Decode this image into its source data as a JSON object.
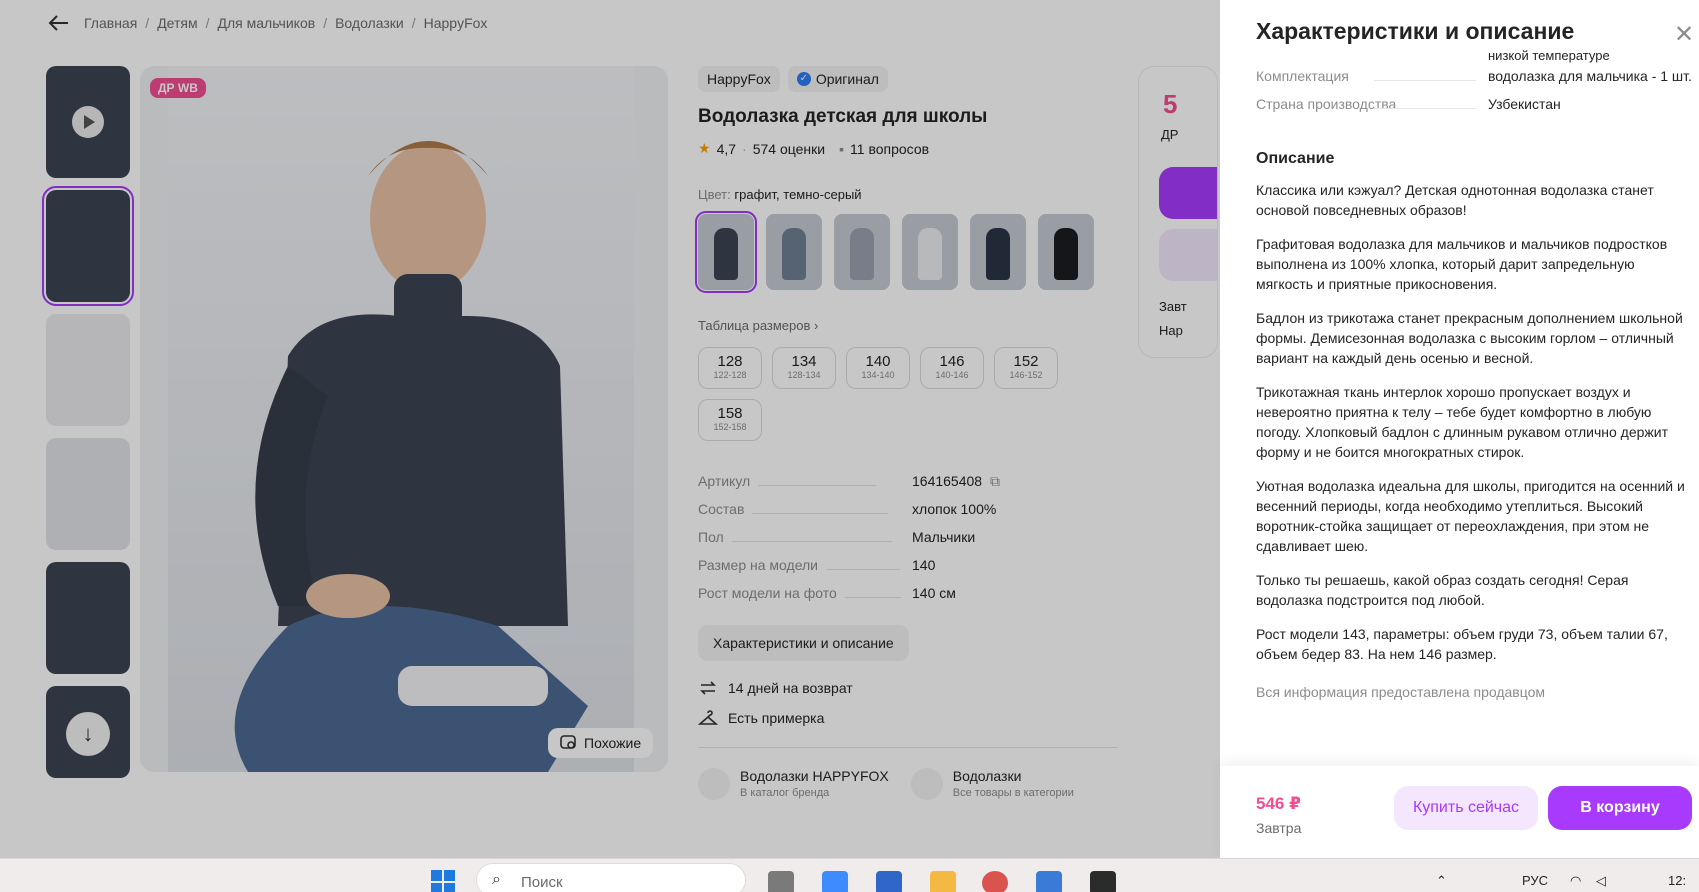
{
  "breadcrumbs": [
    "Главная",
    "Детям",
    "Для мальчиков",
    "Водолазки",
    "HappyFox"
  ],
  "gallery": {
    "badge": "ДР WB",
    "similar_label": "Похожие",
    "thumb_count": 6
  },
  "product": {
    "brand": "HappyFox",
    "original_label": "Оригинал",
    "title": "Водолазка детская для школы",
    "rating": "4,7",
    "reviews": "574 оценки",
    "questions": "11 вопросов",
    "color_label": "Цвет:",
    "color_value": "графит, темно-серый",
    "size_table_link": "Таблица размеров",
    "sizes": [
      {
        "size": "128",
        "range": "122-128"
      },
      {
        "size": "134",
        "range": "128-134"
      },
      {
        "size": "140",
        "range": "134-140"
      },
      {
        "size": "146",
        "range": "140-146"
      },
      {
        "size": "152",
        "range": "146-152"
      },
      {
        "size": "158",
        "range": "152-158"
      }
    ],
    "params": [
      {
        "key": "Артикул",
        "value": "164165408"
      },
      {
        "key": "Состав",
        "value": "хлопок 100%"
      },
      {
        "key": "Пол",
        "value": "Мальчики"
      },
      {
        "key": "Размер на модели",
        "value": "140"
      },
      {
        "key": "Рост модели на фото",
        "value": "140 см"
      }
    ],
    "characteristics_button": "Характеристики и описание",
    "return_label": "14 дней на возврат",
    "fitting_label": "Есть примерка",
    "brand_link": {
      "title": "Водолазки HAPPYFOX",
      "subtitle": "В каталог бренда"
    },
    "category_link": {
      "title": "Водолазки",
      "subtitle": "Все товары в категории"
    }
  },
  "buybox": {
    "price_partial": "5",
    "dr_partial": "ДР",
    "line1": "Завт",
    "line2": "Нар"
  },
  "panel": {
    "title": "Характеристики и описание",
    "cut_text": "низкой температуре",
    "rows": [
      {
        "key": "Комплектация",
        "value": "водолазка для мальчика - 1 шт."
      },
      {
        "key": "Страна производства",
        "value": "Узбекистан"
      }
    ],
    "description_title": "Описание",
    "paragraphs": [
      "Классика или кэжуал? Детская однотонная водолазка станет основой повседневных образов!",
      "Графитовая водолазка для мальчиков и мальчиков подростков выполнена из 100% хлопка, который дарит запредельную мягкость и приятные прикосновения.",
      "Бадлон из трикотажа станет прекрасным дополнением школьной формы. Демисезонная водолазка с высоким горлом – отличный вариант на каждый день осенью и весной.",
      "Трикотажная ткань интерлок хорошо пропускает воздух и невероятно приятна к телу – тебе будет комфортно в любую погоду. Хлопковый бадлон с длинным рукавом отлично держит форму и не боится многократных стирок.",
      "Уютная водолазка идеальна для школы, пригодится на осенний и весенний периоды, когда необходимо утеплиться. Высокий воротник-стойка защищает от переохлаждения, при этом не сдавливает шею.",
      "Только ты решаешь, какой образ создать сегодня! Серая водолазка подстроится под любой.",
      "Рост модели 143, параметры: объем груди 73, объем талии 67, объем бедер 83. На нем 146 размер."
    ],
    "disclaimer": "Вся информация предоставлена продавцом",
    "footer": {
      "price": "546 ₽",
      "delivery": "Завтра",
      "buy_now": "Купить сейчас",
      "to_cart": "В корзину"
    }
  },
  "taskbar": {
    "search_placeholder": "Поиск",
    "lang": "РУС",
    "clock": "12:"
  },
  "colors": {
    "accent": "#a73afd",
    "price": "#f24d93",
    "garment": "#3b4553"
  }
}
